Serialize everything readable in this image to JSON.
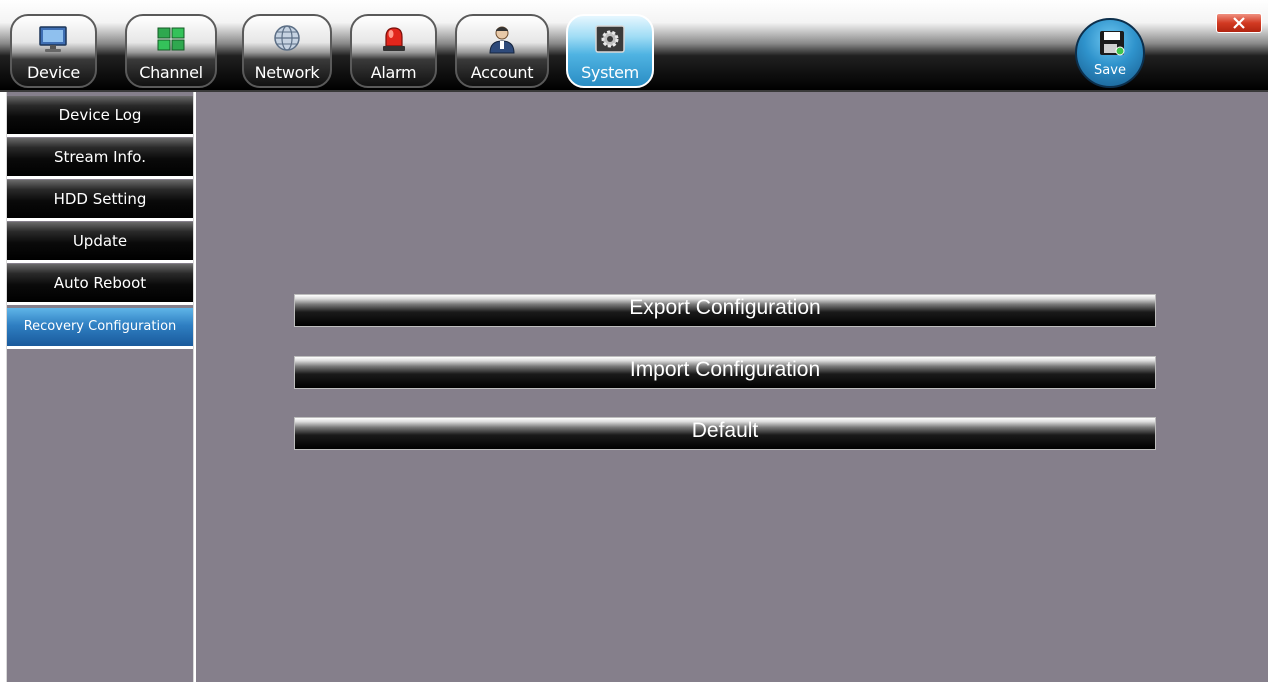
{
  "tabs": [
    {
      "label": "Device",
      "icon": "monitor-icon",
      "active": false
    },
    {
      "label": "Channel",
      "icon": "grid-icon",
      "active": false
    },
    {
      "label": "Network",
      "icon": "globe-icon",
      "active": false
    },
    {
      "label": "Alarm",
      "icon": "siren-icon",
      "active": false
    },
    {
      "label": "Account",
      "icon": "user-icon",
      "active": false
    },
    {
      "label": "System",
      "icon": "gear-icon",
      "active": true
    }
  ],
  "save": {
    "label": "Save",
    "icon": "floppy-disk-icon"
  },
  "close": {
    "icon": "close-icon"
  },
  "sidebar": {
    "items": [
      {
        "label": "Device Log",
        "active": false
      },
      {
        "label": "Stream Info.",
        "active": false
      },
      {
        "label": "HDD Setting",
        "active": false
      },
      {
        "label": "Update",
        "active": false
      },
      {
        "label": "Auto Reboot",
        "active": false
      },
      {
        "label": "Recovery Configuration",
        "active": true
      }
    ]
  },
  "main": {
    "buttons": [
      {
        "label": "Export Configuration"
      },
      {
        "label": "Import Configuration"
      },
      {
        "label": "Default"
      }
    ]
  },
  "colors": {
    "panel_bg": "#857f8b",
    "active_blue": "#2f7fc2",
    "close_red": "#d23a22"
  }
}
